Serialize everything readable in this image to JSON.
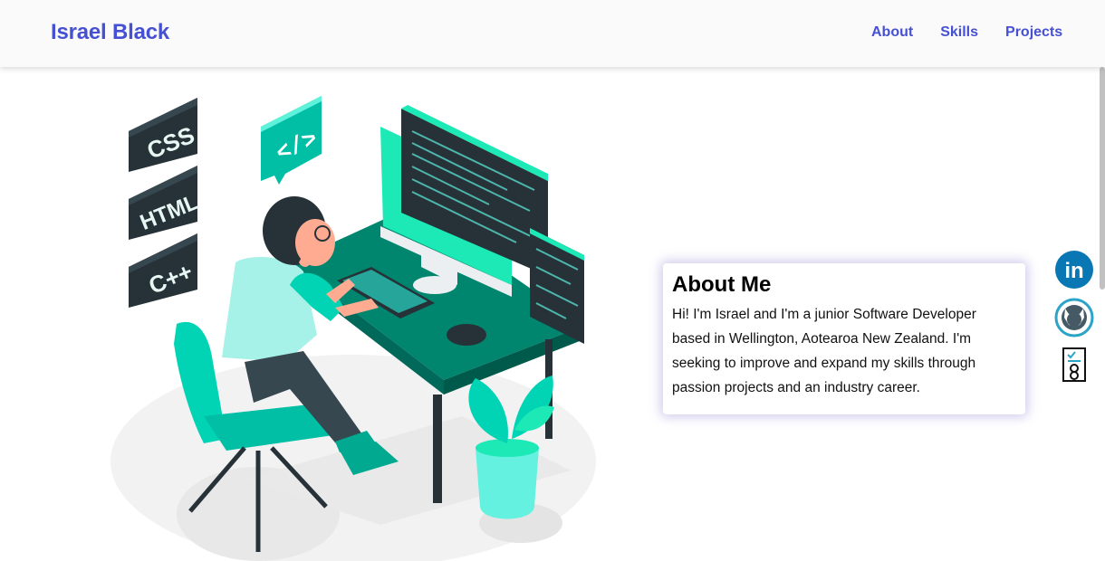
{
  "nav": {
    "brand": "Israel Black",
    "links": [
      {
        "label": "About"
      },
      {
        "label": "Skills"
      },
      {
        "label": "Projects"
      }
    ]
  },
  "hero": {
    "badges": [
      "CSS",
      "HTML",
      "C++"
    ],
    "code_bubble": "</>",
    "colors": {
      "accent": "#00d4b4",
      "dark": "#263238",
      "desk": "#00856e"
    }
  },
  "about": {
    "title": "About Me",
    "text": "Hi! I'm Israel and I'm a junior Software Developer based in Wellington, Aotearoa New Zealand. I'm seeking to improve and expand my skills through passion projects and an industry career."
  },
  "social": {
    "linkedin_text": "in",
    "items": [
      "linkedin-icon",
      "github-icon",
      "resume-icon"
    ]
  }
}
